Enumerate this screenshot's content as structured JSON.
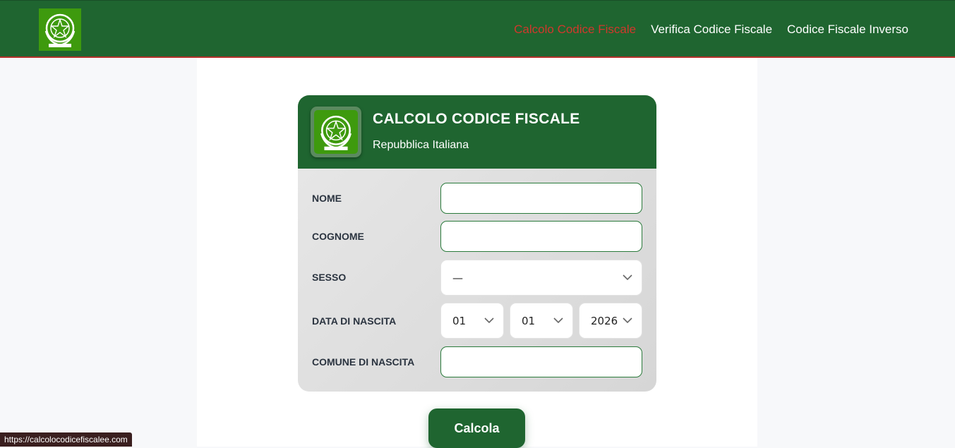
{
  "nav": {
    "logo_icon": "emblem-icon",
    "links": [
      {
        "label": "Calcolo Codice Fiscale",
        "active": true
      },
      {
        "label": "Verifica Codice Fiscale",
        "active": false
      },
      {
        "label": "Codice Fiscale Inverso",
        "active": false
      }
    ]
  },
  "card": {
    "title": "CALCOLO CODICE FISCALE",
    "subtitle": "Repubblica Italiana",
    "logo_icon": "emblem-icon"
  },
  "form": {
    "nome_label": "NOME",
    "nome_value": "",
    "cognome_label": "COGNOME",
    "cognome_value": "",
    "sesso_label": "SESSO",
    "sesso_value": "—",
    "data_label": "DATA DI NASCITA",
    "giorno_value": "01",
    "mese_value": "01",
    "anno_value": "2026",
    "comune_label": "COMUNE DI NASCITA",
    "comune_value": ""
  },
  "button": {
    "label": "Calcola"
  },
  "status": {
    "url": "https://calcolocodicefiscalee.com"
  },
  "colors": {
    "brand_green": "#1f6530",
    "logo_green": "#3e9a0e",
    "active_link": "#d0382c",
    "accent_border": "#b3312a"
  }
}
